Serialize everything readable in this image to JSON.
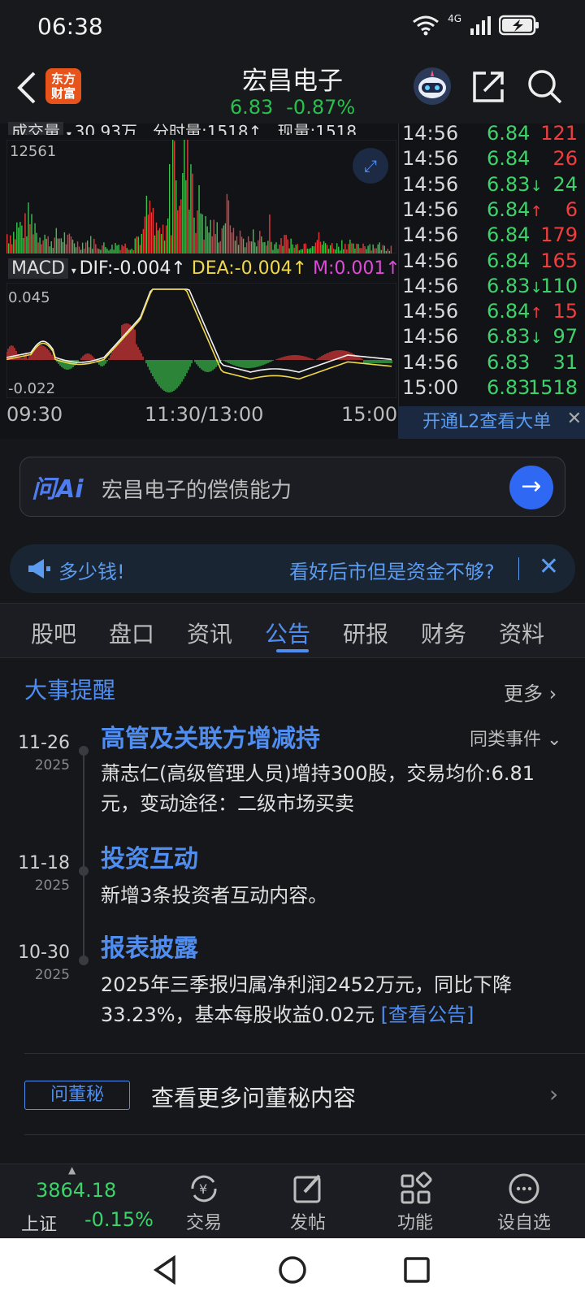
{
  "status": {
    "time": "06:38",
    "net": "4G"
  },
  "header": {
    "back_icon": "chevron-left-icon",
    "logo_line1": "东方",
    "logo_line2": "财富",
    "title": "宏昌电子",
    "price": "6.83",
    "change": "-0.87%"
  },
  "chart": {
    "volume_label": "成交量",
    "volume_text": "30.93万",
    "fenshi_text": "分时量:1518↑",
    "now_text": "现量:1518",
    "vol_max": "12561",
    "macd_label": "MACD",
    "dif_text": "DIF:-0.004↑",
    "dea_text": "DEA:-0.004↑",
    "m_text": "M:0.001↑",
    "macd_max": "0.045",
    "macd_min": "-0.022",
    "x_ticks": [
      "09:30",
      "11:30/13:00",
      "15:00"
    ]
  },
  "ticks": [
    {
      "time": "14:56",
      "price": "6.84",
      "arrow": "",
      "vol": "121",
      "vol_color": "#f03e3e"
    },
    {
      "time": "14:56",
      "price": "6.84",
      "arrow": "",
      "vol": "26",
      "vol_color": "#f03e3e"
    },
    {
      "time": "14:56",
      "price": "6.83",
      "arrow": "↓",
      "vol": "24",
      "vol_color": "#3ed26a"
    },
    {
      "time": "14:56",
      "price": "6.84",
      "arrow": "↑",
      "vol": "6",
      "vol_color": "#f03e3e"
    },
    {
      "time": "14:56",
      "price": "6.84",
      "arrow": "",
      "vol": "179",
      "vol_color": "#f03e3e"
    },
    {
      "time": "14:56",
      "price": "6.84",
      "arrow": "",
      "vol": "165",
      "vol_color": "#f03e3e"
    },
    {
      "time": "14:56",
      "price": "6.83",
      "arrow": "↓",
      "vol": "110",
      "vol_color": "#3ed26a"
    },
    {
      "time": "14:56",
      "price": "6.84",
      "arrow": "↑",
      "vol": "15",
      "vol_color": "#f03e3e"
    },
    {
      "time": "14:56",
      "price": "6.83",
      "arrow": "↓",
      "vol": "97",
      "vol_color": "#3ed26a"
    },
    {
      "time": "14:56",
      "price": "6.83",
      "arrow": "",
      "vol": "31",
      "vol_color": "#3ed26a"
    },
    {
      "time": "15:00",
      "price": "6.83",
      "arrow": "",
      "vol": "1518",
      "vol_color": "#3ed26a"
    }
  ],
  "l2": {
    "label": "开通L2查看大单",
    "close": "✕"
  },
  "ask": {
    "brand": "问Ai",
    "question": "宏昌电子的偿债能力",
    "go": "→"
  },
  "ad": {
    "left": "多少钱!",
    "right": "看好后市但是资金不够?",
    "close": "✕"
  },
  "tabs": [
    "股吧",
    "盘口",
    "资讯",
    "公告",
    "研报",
    "财务",
    "资料"
  ],
  "active_tab": "公告",
  "events": {
    "section_title": "大事提醒",
    "more": "更多 ›",
    "same_type": "同类事件 ⌄",
    "items": [
      {
        "date": "11-26",
        "year": "2025",
        "title": "高管及关联方增减持",
        "body": "萧志仁(高级管理人员)增持300股，交易均价:6.81元，变动途径：二级市场买卖"
      },
      {
        "date": "11-18",
        "year": "2025",
        "title": "投资互动",
        "body": "新增3条投资者互动内容。"
      },
      {
        "date": "10-30",
        "year": "2025",
        "title": "报表披露",
        "body": "2025年三季报归属净利润2452万元，同比下降33.23%，基本每股收益0.02元 ",
        "link": "[查看公告]"
      }
    ]
  },
  "qa": {
    "tag": "问董秘",
    "text": "查看更多问董秘内容",
    "arrow": "›"
  },
  "bottom": {
    "index_value": "3864.18",
    "index_name": "上证",
    "index_change": "-0.15%",
    "nav": [
      {
        "label": "交易",
        "icon": "yen-refresh-icon"
      },
      {
        "label": "发帖",
        "icon": "edit-icon"
      },
      {
        "label": "功能",
        "icon": "grid-icon"
      },
      {
        "label": "设自选",
        "icon": "more-circle-icon"
      }
    ]
  }
}
